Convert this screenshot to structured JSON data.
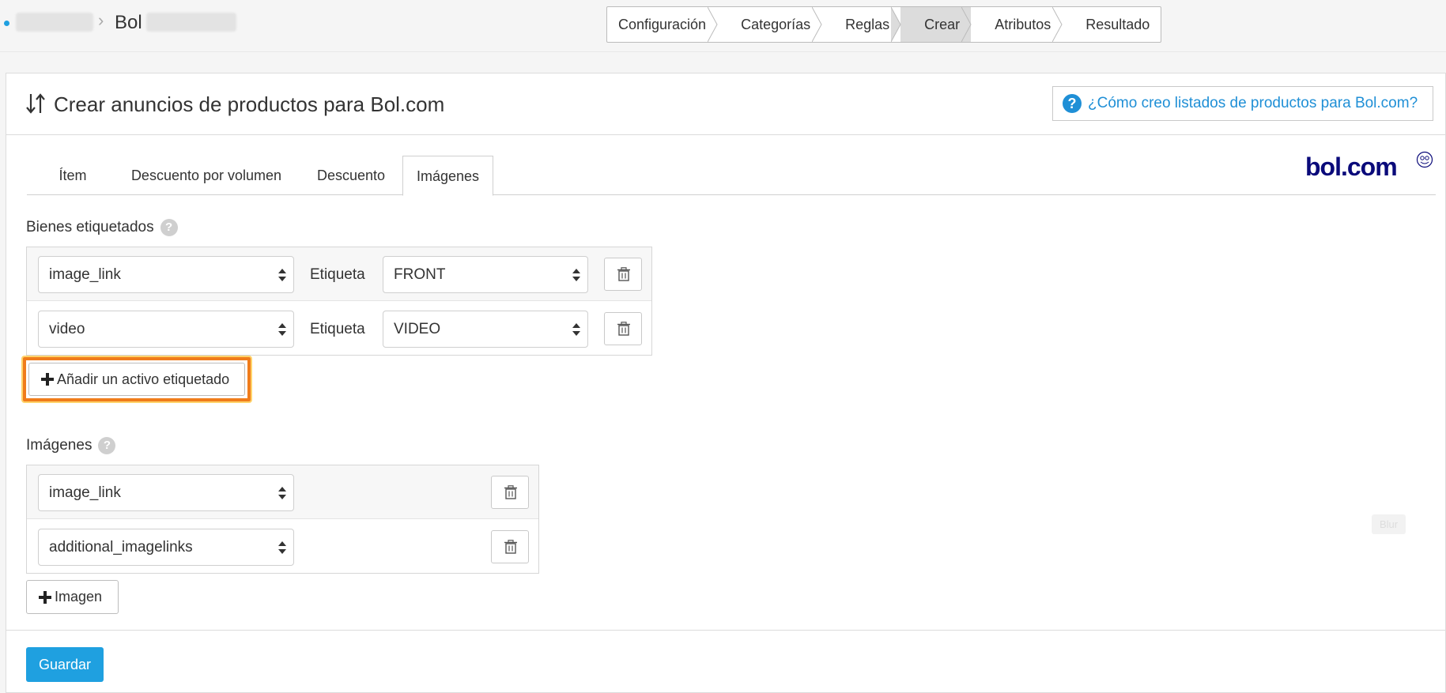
{
  "breadcrumb": {
    "current": "Bol",
    "separator": "›"
  },
  "wizard": {
    "steps": [
      "Configuración",
      "Categorías",
      "Reglas",
      "Crear",
      "Atributos",
      "Resultado"
    ],
    "active": "Crear"
  },
  "header": {
    "title": "Crear anuncios de productos para Bol.com",
    "help_link": "¿Cómo creo listados de productos para Bol.com?"
  },
  "tabs": [
    "Ítem",
    "Descuento por volumen",
    "Descuento",
    "Imágenes"
  ],
  "active_tab": "Imágenes",
  "logo": {
    "text": "bol.com"
  },
  "tagged_assets": {
    "label": "Bienes etiquetados",
    "help_icon": "?",
    "tag_label": "Etiqueta",
    "rows": [
      {
        "field": "image_link",
        "tag": "FRONT"
      },
      {
        "field": "video",
        "tag": "VIDEO"
      }
    ],
    "add_button": "Añadir un activo etiquetado"
  },
  "images": {
    "label": "Imágenes",
    "help_icon": "?",
    "rows": [
      {
        "field": "image_link"
      },
      {
        "field": "additional_imagelinks"
      }
    ],
    "add_button": "Imagen"
  },
  "save_button": "Guardar",
  "blur_tag": "Blur",
  "colors": {
    "accent": "#1fa0e0",
    "link": "#1f8fd6",
    "highlight": "#f07c1b",
    "logo": "#0a0a7a"
  }
}
